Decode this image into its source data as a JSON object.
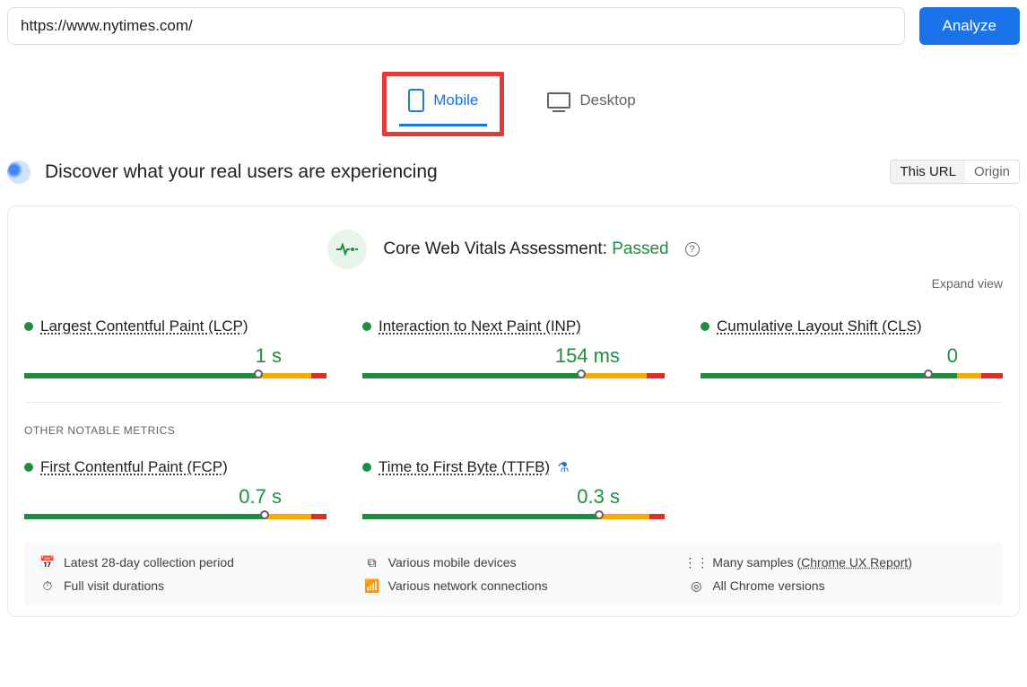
{
  "search": {
    "value": "https://www.nytimes.com/",
    "analyze_label": "Analyze"
  },
  "tabs": {
    "mobile": "Mobile",
    "desktop": "Desktop"
  },
  "header": {
    "title": "Discover what your real users are experiencing",
    "this_url": "This URL",
    "origin": "Origin"
  },
  "assessment": {
    "label": "Core Web Vitals Assessment: ",
    "status": "Passed",
    "expand": "Expand view"
  },
  "metrics": {
    "lcp": {
      "label": "Largest Contentful Paint (LCP)",
      "value": "1 s",
      "green": 77,
      "orange": 18,
      "red": 5,
      "marker": 77
    },
    "inp": {
      "label": "Interaction to Next Paint (INP)",
      "value": "154 ms",
      "green": 72,
      "orange": 22,
      "red": 6,
      "marker": 72
    },
    "cls": {
      "label": "Cumulative Layout Shift (CLS)",
      "value": "0",
      "green": 85,
      "orange": 8,
      "red": 7,
      "marker": 75
    },
    "fcp": {
      "label": "First Contentful Paint (FCP)",
      "value": "0.7 s",
      "green": 79,
      "orange": 16,
      "red": 5,
      "marker": 79
    },
    "ttfb": {
      "label": "Time to First Byte (TTFB)",
      "value": "0.3 s",
      "green": 78,
      "orange": 17,
      "red": 5,
      "marker": 78
    }
  },
  "section_other": "OTHER NOTABLE METRICS",
  "footer": {
    "period": "Latest 28-day collection period",
    "devices": "Various mobile devices",
    "samples_prefix": "Many samples (",
    "samples_link": "Chrome UX Report",
    "samples_suffix": ")",
    "durations": "Full visit durations",
    "network": "Various network connections",
    "versions": "All Chrome versions"
  }
}
